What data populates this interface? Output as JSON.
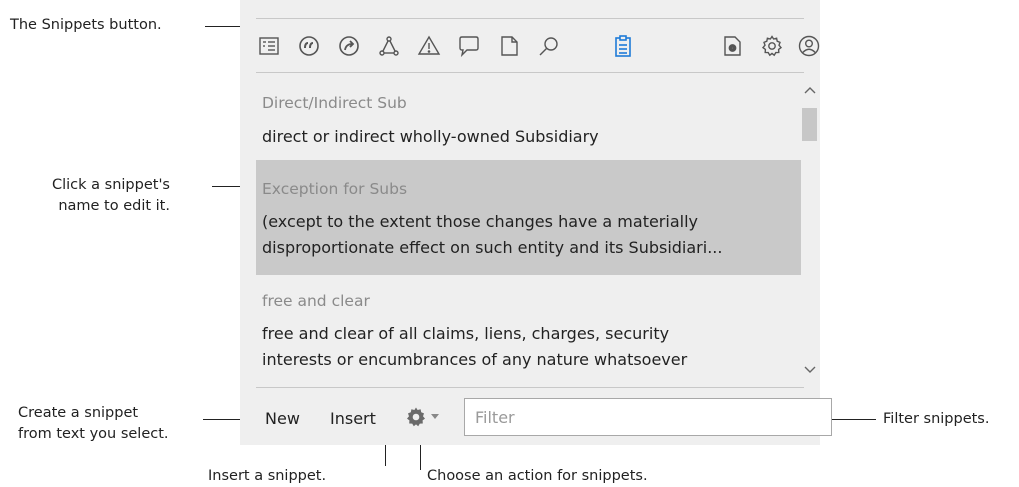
{
  "callouts": {
    "snippets_button": "The Snippets button.",
    "click_name_l1": "Click a snippet's",
    "click_name_l2": "name to edit it.",
    "create_l1": "Create a snippet",
    "create_l2": "from text you select.",
    "insert": "Insert a snippet.",
    "action": "Choose an action for snippets.",
    "filter": "Filter snippets."
  },
  "toolbar": {
    "icons": [
      "outline-icon",
      "quote-icon",
      "share-icon",
      "graph-icon",
      "warning-icon",
      "comment-icon",
      "document-icon",
      "search-icon",
      "snippets-icon",
      "doc-settings-icon",
      "gear-icon",
      "user-icon"
    ],
    "accent_color": "#1e7bd8"
  },
  "snippets": [
    {
      "name": "Direct/Indirect Sub",
      "text_l1": "direct or indirect wholly-owned Subsidiary",
      "text_l2": ""
    },
    {
      "name": "Exception for Subs",
      "text_l1": "(except to the extent those changes have a materially",
      "text_l2": "disproportionate effect on such entity and its Subsidiari..."
    },
    {
      "name": "free and clear",
      "text_l1": "free and clear of all claims, liens, charges, security",
      "text_l2": "interests or encumbrances of any nature whatsoever"
    }
  ],
  "bottom": {
    "new_label": "New",
    "insert_label": "Insert",
    "filter_placeholder": "Filter"
  }
}
